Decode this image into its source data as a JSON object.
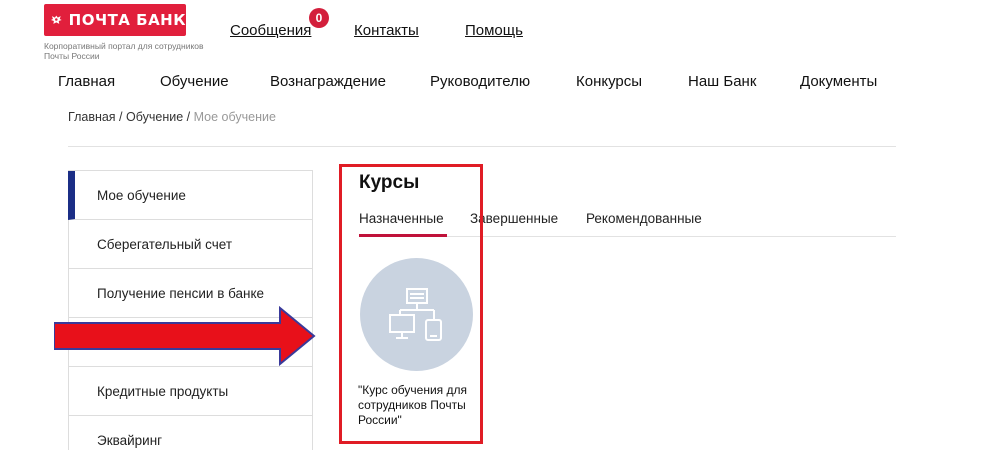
{
  "header": {
    "logo_text": "ПОЧТА БАНК",
    "subtitle": "Корпоративный портал для сотрудников Почты России",
    "links": [
      {
        "label": "Сообщения",
        "badge": "0"
      },
      {
        "label": "Контакты"
      },
      {
        "label": "Помощь"
      }
    ]
  },
  "nav": [
    "Главная",
    "Обучение",
    "Вознаграждение",
    "Руководителю",
    "Конкурсы",
    "Наш Банк",
    "Документы"
  ],
  "breadcrumb": {
    "items": [
      "Главная",
      "Обучение"
    ],
    "separator": " / ",
    "current": "Мое обучение"
  },
  "sidebar": {
    "items": [
      {
        "label": "Мое обучение",
        "active": true
      },
      {
        "label": "Сберегательный счет"
      },
      {
        "label": "Получение пенсии в банке"
      },
      {
        "label": ""
      },
      {
        "label": "Кредитные продукты"
      },
      {
        "label": "Эквайринг"
      }
    ]
  },
  "courses": {
    "title": "Курсы",
    "tabs": [
      "Назначенные",
      "Завершенные",
      "Рекомендованные"
    ],
    "active_tab": "Назначенные",
    "card": {
      "icon": "computer-network-icon",
      "title": "\"Курс обучения для сотрудников Почты России\""
    }
  },
  "colors": {
    "brand": "#e11f3c",
    "sidebar_active": "#1b2e86",
    "tab_active": "#c0123a",
    "highlight": "#e01c25",
    "arrow": "#e8101a",
    "course_circle": "#c9d3e0"
  }
}
